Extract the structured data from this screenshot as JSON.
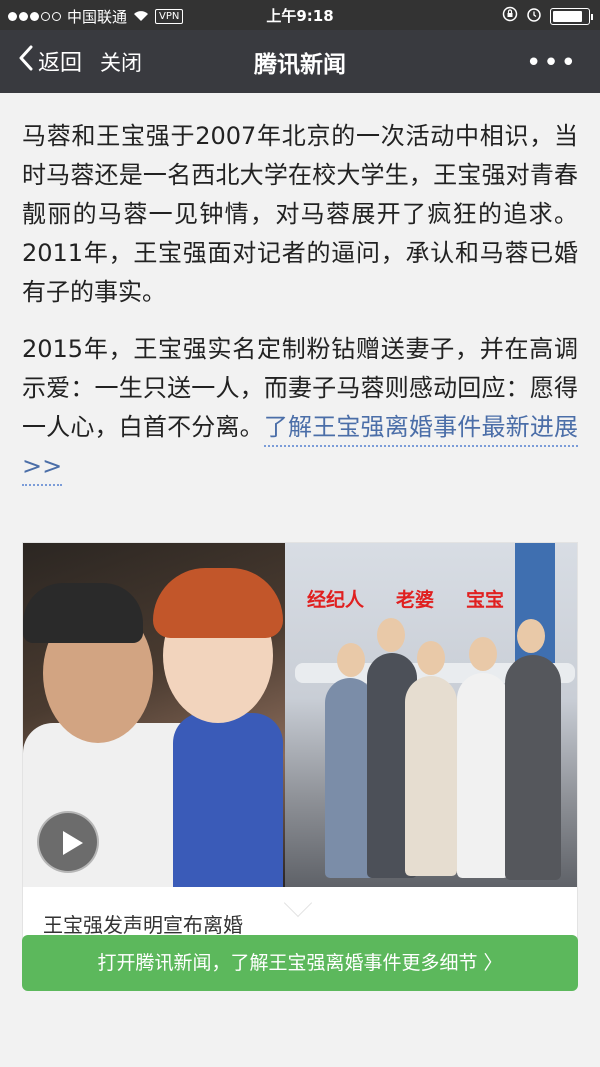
{
  "status_bar": {
    "carrier": "中国联通",
    "vpn": "VPN",
    "time": "上午9:18",
    "battery_level": 0.85
  },
  "nav": {
    "back_label": "返回",
    "close_label": "关闭",
    "title": "腾讯新闻",
    "more_label": "•••"
  },
  "article": {
    "paragraph1": "马蓉和王宝强于2007年北京的一次活动中相识，当时马蓉还是一名西北大学在校大学生，王宝强对青春靓丽的马蓉一见钟情，对马蓉展开了疯狂的追求。2011年，王宝强面对记者的逼问，承认和马蓉已婚有子的事实。",
    "paragraph2": "2015年，王宝强实名定制粉钻赠送妻子，并在高调示爱：一生只送一人，而妻子马蓉则感动回应：愿得一人心，白首不分离。",
    "more_link": "了解王宝强离婚事件最新进展>>"
  },
  "video": {
    "tags": [
      "经纪人",
      "老婆",
      "宝宝"
    ],
    "caption": "王宝强发声明宣布离婚"
  },
  "cta": {
    "label": "打开腾讯新闻，了解王宝强离婚事件更多细节 〉"
  }
}
